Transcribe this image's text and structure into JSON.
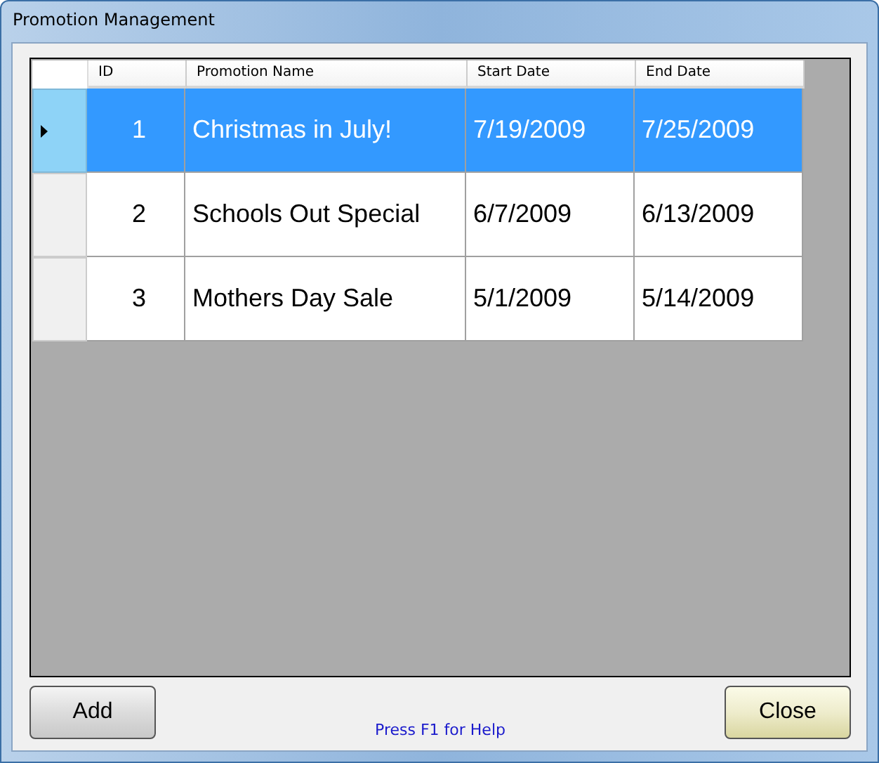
{
  "window": {
    "title": "Promotion Management"
  },
  "table": {
    "columns": [
      "ID",
      "Promotion Name",
      "Start Date",
      "End Date"
    ],
    "rows": [
      {
        "cells": [
          "1",
          "Christmas in July!",
          "7/19/2009",
          "7/25/2009"
        ],
        "selected": true
      },
      {
        "cells": [
          "2",
          "Schools Out Special",
          "6/7/2009",
          "6/13/2009"
        ],
        "selected": false
      },
      {
        "cells": [
          "3",
          "Mothers Day Sale",
          "5/1/2009",
          "5/14/2009"
        ],
        "selected": false
      }
    ]
  },
  "buttons": [
    {
      "label": "Add",
      "kind": "default"
    },
    {
      "label": "Close",
      "kind": "accent"
    }
  ],
  "help": "Press F1 for Help"
}
